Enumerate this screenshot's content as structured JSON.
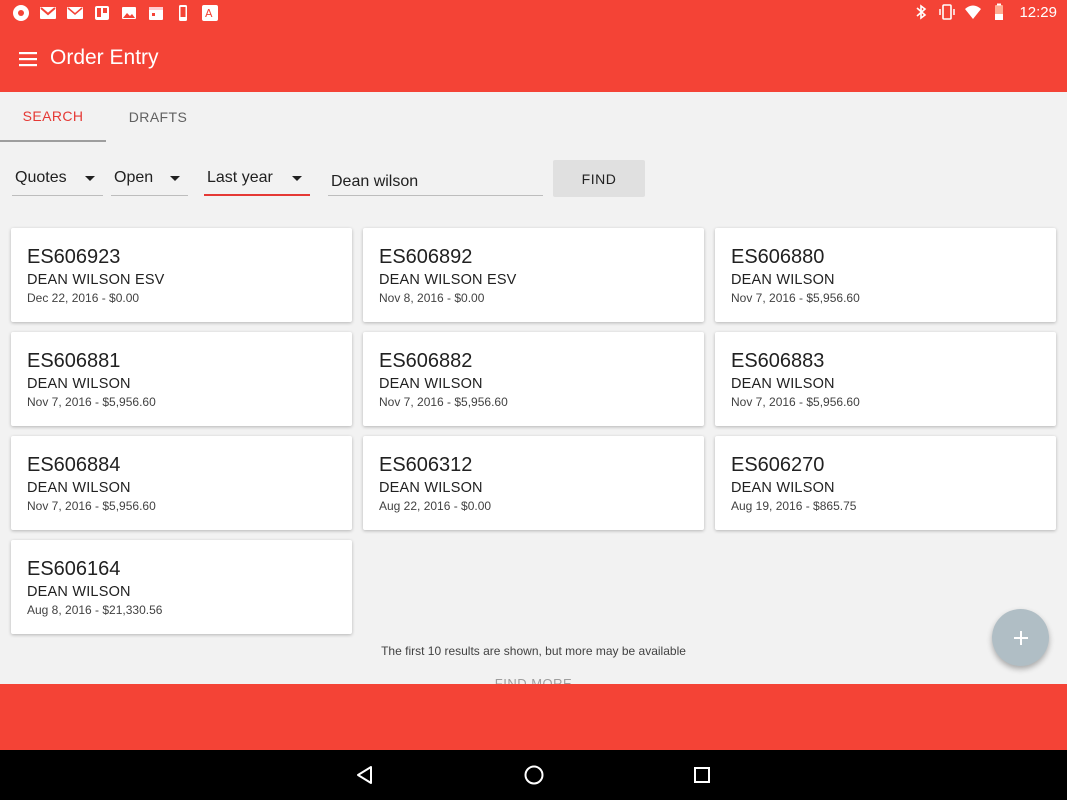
{
  "status_bar": {
    "time": "12:29",
    "left_icons": [
      "app-icon",
      "gmail-icon",
      "mail-icon",
      "trello-icon",
      "image-icon",
      "calendar-icon",
      "phone-icon",
      "translate-icon"
    ],
    "right_icons": [
      "bluetooth-icon",
      "vibrate-icon",
      "wifi-icon",
      "battery-icon"
    ]
  },
  "app_bar": {
    "title": "Order Entry"
  },
  "tabs": [
    {
      "label": "SEARCH",
      "active": true
    },
    {
      "label": "DRAFTS",
      "active": false
    }
  ],
  "filters": {
    "type": "Quotes",
    "status": "Open",
    "range": "Last year",
    "search_value": "Dean wilson",
    "find_label": "FIND"
  },
  "results": [
    {
      "number": "ES606923",
      "customer": "DEAN WILSON ESV",
      "meta": "Dec 22, 2016 - $0.00"
    },
    {
      "number": "ES606892",
      "customer": "DEAN WILSON ESV",
      "meta": "Nov 8, 2016 - $0.00"
    },
    {
      "number": "ES606880",
      "customer": "DEAN WILSON",
      "meta": "Nov 7, 2016 - $5,956.60"
    },
    {
      "number": "ES606881",
      "customer": "DEAN WILSON",
      "meta": "Nov 7, 2016 - $5,956.60"
    },
    {
      "number": "ES606882",
      "customer": "DEAN WILSON",
      "meta": "Nov 7, 2016 - $5,956.60"
    },
    {
      "number": "ES606883",
      "customer": "DEAN WILSON",
      "meta": "Nov 7, 2016 - $5,956.60"
    },
    {
      "number": "ES606884",
      "customer": "DEAN WILSON",
      "meta": "Nov 7, 2016 - $5,956.60"
    },
    {
      "number": "ES606312",
      "customer": "DEAN WILSON",
      "meta": "Aug 22, 2016 - $0.00"
    },
    {
      "number": "ES606270",
      "customer": "DEAN WILSON",
      "meta": "Aug 19, 2016 - $865.75"
    },
    {
      "number": "ES606164",
      "customer": "DEAN WILSON",
      "meta": "Aug 8, 2016 - $21,330.56"
    }
  ],
  "notice": "The first 10 results are shown, but more may be available",
  "find_more_label": "FIND MORE",
  "colors": {
    "primary": "#f44336",
    "accent": "#e53935",
    "fab": "#b0bec5"
  }
}
